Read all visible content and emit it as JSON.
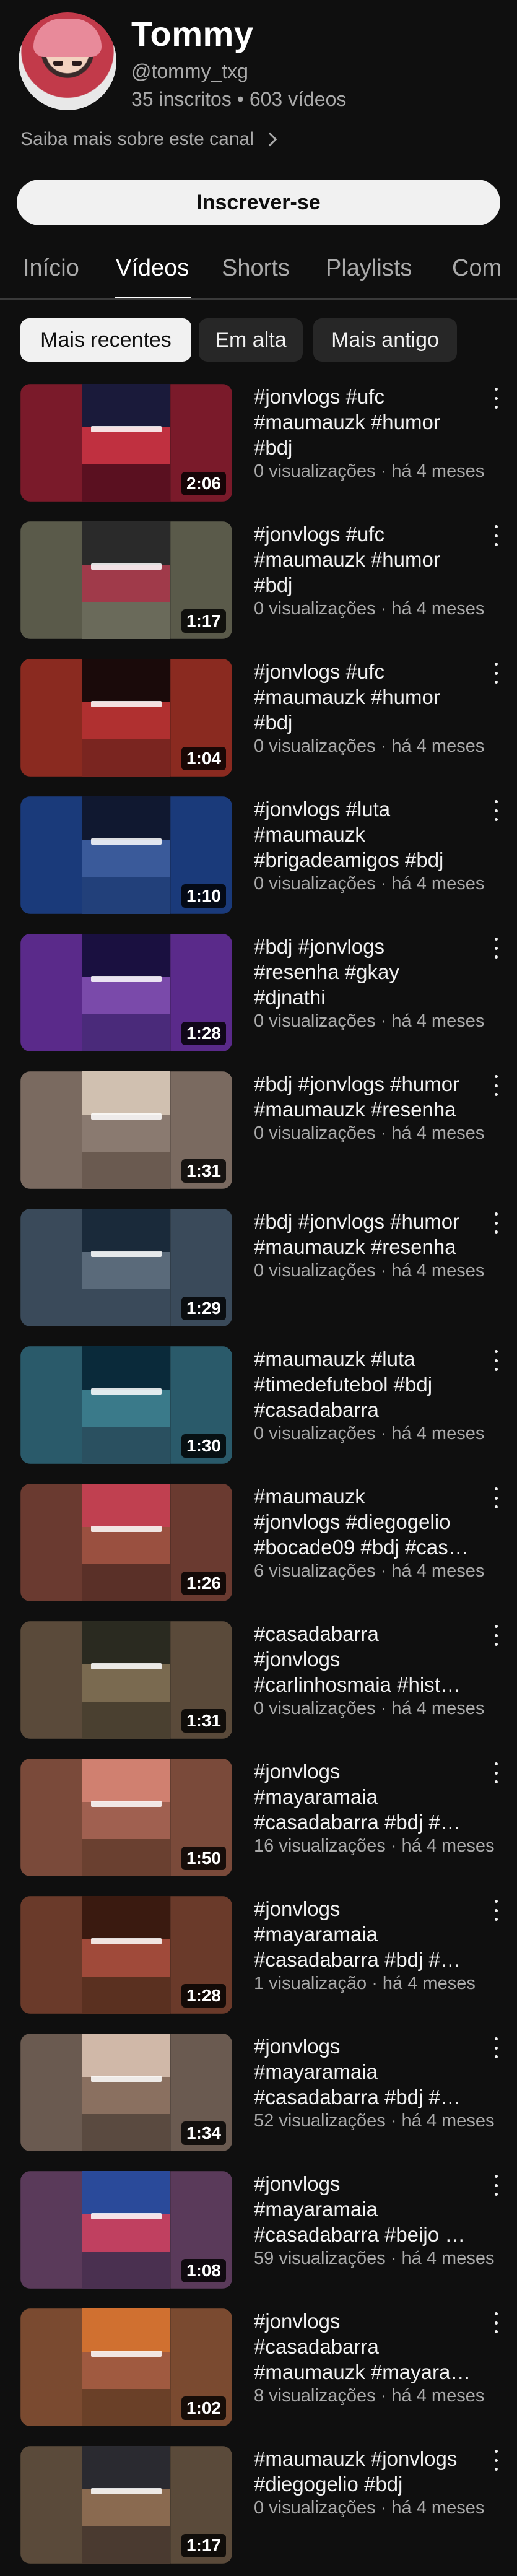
{
  "channel": {
    "name": "Tommy",
    "handle": "@tommy_txg",
    "stats": "35 inscritos • 603 vídeos",
    "about_link": "Saiba mais sobre este canal",
    "subscribe_label": "Inscrever-se"
  },
  "tabs": [
    {
      "label": "Início"
    },
    {
      "label": "Vídeos",
      "active": true
    },
    {
      "label": "Shorts"
    },
    {
      "label": "Playlists"
    },
    {
      "label": "Com"
    }
  ],
  "chips": [
    {
      "label": "Mais recentes",
      "selected": true
    },
    {
      "label": "Em alta"
    },
    {
      "label": "Mais antigo"
    }
  ],
  "videos": [
    {
      "title": "#jonvlogs #ufc\n#maumauzk #humor\n#bdj",
      "meta": "0 visualizações · há 4 meses",
      "duration": "2:06",
      "colors": [
        "#7a1a2a",
        "#1a1a3a",
        "#c03040",
        "#5a1020"
      ]
    },
    {
      "title": "#jonvlogs #ufc\n#maumauzk #humor\n#bdj",
      "meta": "0 visualizações · há 4 meses",
      "duration": "1:17",
      "colors": [
        "#5a5a4a",
        "#2a2a2a",
        "#a03a4a",
        "#6a6a5a"
      ]
    },
    {
      "title": "#jonvlogs #ufc\n#maumauzk #humor\n#bdj",
      "meta": "0 visualizações · há 4 meses",
      "duration": "1:04",
      "colors": [
        "#8a2a20",
        "#1a0a0a",
        "#b03030",
        "#7a2520"
      ]
    },
    {
      "title": "#jonvlogs #luta\n#maumauzk\n#brigadeamigos #bdj",
      "meta": "0 visualizações · há 4 meses",
      "duration": "1:10",
      "colors": [
        "#1a3a7a",
        "#101830",
        "#3a5a9a",
        "#22407a"
      ]
    },
    {
      "title": "#bdj #jonvlogs\n#resenha  #gkay\n#djnathi",
      "meta": "0 visualizações · há 4 meses",
      "duration": "1:28",
      "colors": [
        "#5a2a8a",
        "#1a1040",
        "#7a4aaa",
        "#4a2a7a"
      ]
    },
    {
      "title": "#bdj #jonvlogs #humor\n#maumauzk #resenha",
      "meta": "0 visualizações · há 4 meses",
      "duration": "1:31",
      "colors": [
        "#7a6a60",
        "#d0c0b0",
        "#8a7a70",
        "#6a5a50"
      ]
    },
    {
      "title": "#bdj #jonvlogs #humor\n#maumauzk #resenha",
      "meta": "0 visualizações · há 4 meses",
      "duration": "1:29",
      "colors": [
        "#3a4a5a",
        "#1a2a3a",
        "#5a6a7a",
        "#3a4a5a"
      ]
    },
    {
      "title": "#maumauzk #luta\n#timedefutebol #bdj\n#casadabarra",
      "meta": "0 visualizações · há 4 meses",
      "duration": "1:30",
      "colors": [
        "#2a5a6a",
        "#0a2a3a",
        "#3a7a8a",
        "#2a5060"
      ]
    },
    {
      "title": "#maumauzk\n#jonvlogs #diegogelio\n#bocade09 #bdj #cas…",
      "meta": "6 visualizações · há 4 meses",
      "duration": "1:26",
      "colors": [
        "#6a3a30",
        "#c04050",
        "#9a5040",
        "#5a3028"
      ]
    },
    {
      "title": "#casadabarra\n#jonvlogs\n#carlinhosmaia #hist…",
      "meta": "0 visualizações · há 4 meses",
      "duration": "1:31",
      "colors": [
        "#5a4a3a",
        "#2a2a20",
        "#7a6a50",
        "#4a4030"
      ]
    },
    {
      "title": "#jonvlogs\n#mayaramaia\n#casadabarra #bdj #…",
      "meta": "16 visualizações · há 4 meses",
      "duration": "1:50",
      "colors": [
        "#7a4a3a",
        "#d08070",
        "#a06050",
        "#6a4030"
      ]
    },
    {
      "title": "#jonvlogs\n#mayaramaia\n#casadabarra #bdj #…",
      "meta": "1 visualização · há 4 meses",
      "duration": "1:28",
      "colors": [
        "#6a3a2a",
        "#3a1a10",
        "#a04a3a",
        "#5a3020"
      ]
    },
    {
      "title": "#jonvlogs\n#mayaramaia\n#casadabarra #bdj #…",
      "meta": "52 visualizações · há 4 meses",
      "duration": "1:34",
      "colors": [
        "#6a5a50",
        "#d0b8a8",
        "#8a7060",
        "#5a4a40"
      ]
    },
    {
      "title": "#jonvlogs\n#mayaramaia\n#casadabarra #beijo …",
      "meta": "59 visualizações · há 4 meses",
      "duration": "1:08",
      "colors": [
        "#5a3a5a",
        "#2a4a9a",
        "#c04060",
        "#4a3050"
      ]
    },
    {
      "title": "#jonvlogs\n#casadabarra\n#maumauzk #mayara…",
      "meta": "8 visualizações · há 4 meses",
      "duration": "1:02",
      "colors": [
        "#7a4a30",
        "#d07030",
        "#a05a40",
        "#6a4028"
      ]
    },
    {
      "title": "#maumauzk #jonvlogs\n#diegogelio #bdj",
      "meta": "0 visualizações · há 4 meses",
      "duration": "1:17",
      "colors": [
        "#5a4a3a",
        "#2a2a30",
        "#8a6a50",
        "#4a3a30"
      ]
    }
  ]
}
